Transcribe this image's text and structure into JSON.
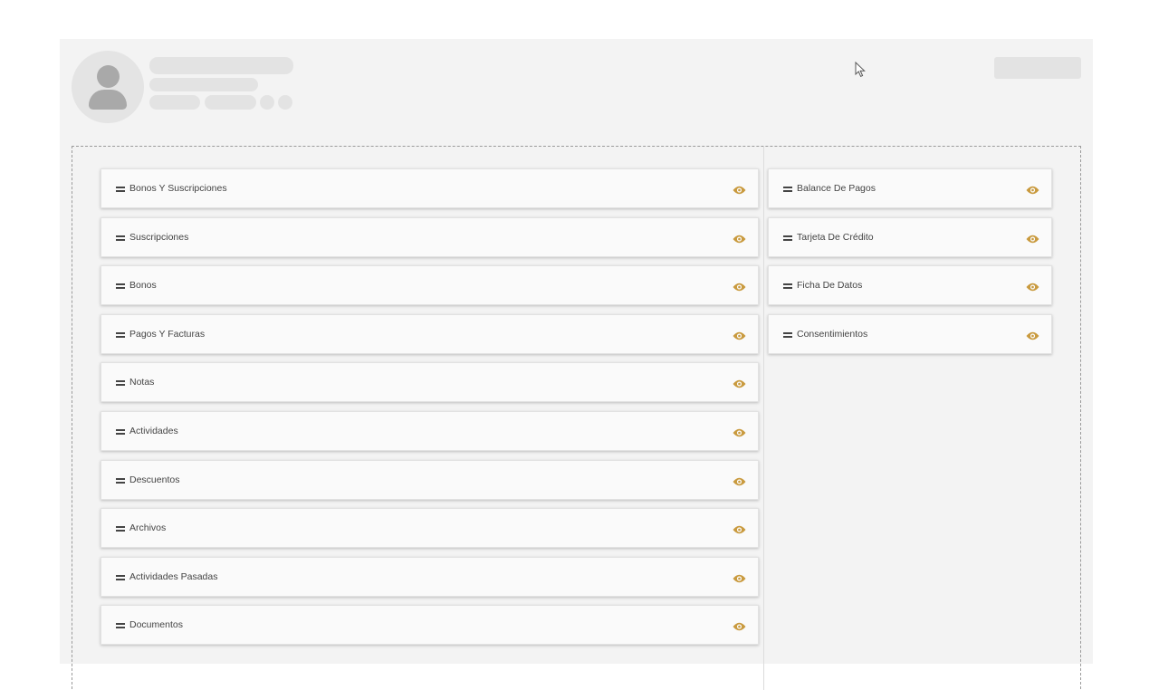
{
  "layout_editor": {
    "left_column": [
      {
        "label": "Bonos Y Suscripciones",
        "icon": "eye-icon"
      },
      {
        "label": "Suscripciones",
        "icon": "eye-icon"
      },
      {
        "label": "Bonos",
        "icon": "eye-icon"
      },
      {
        "label": "Pagos Y Facturas",
        "icon": "eye-icon"
      },
      {
        "label": "Notas",
        "icon": "eye-icon"
      },
      {
        "label": "Actividades",
        "icon": "eye-icon"
      },
      {
        "label": "Descuentos",
        "icon": "eye-icon"
      },
      {
        "label": "Archivos",
        "icon": "eye-icon"
      },
      {
        "label": "Actividades Pasadas",
        "icon": "eye-icon"
      },
      {
        "label": "Documentos",
        "icon": "eye-icon"
      }
    ],
    "right_column": [
      {
        "label": "Balance De Pagos",
        "icon": "eye-icon"
      },
      {
        "label": "Tarjeta De Crédito",
        "icon": "eye-icon"
      },
      {
        "label": "Ficha De Datos",
        "icon": "eye-icon"
      },
      {
        "label": "Consentimientos",
        "icon": "eye-icon"
      }
    ]
  },
  "colors": {
    "accent": "#c99a3e",
    "card_background": "#f3f3f3",
    "skeleton": "#e3e3e3",
    "avatar_figure": "#a9a9a9"
  },
  "icons": {
    "avatar": "user-silhouette-icon",
    "drag": "drag-handle-icon",
    "visibility": "eye-icon",
    "cursor": "mouse-pointer-icon"
  }
}
